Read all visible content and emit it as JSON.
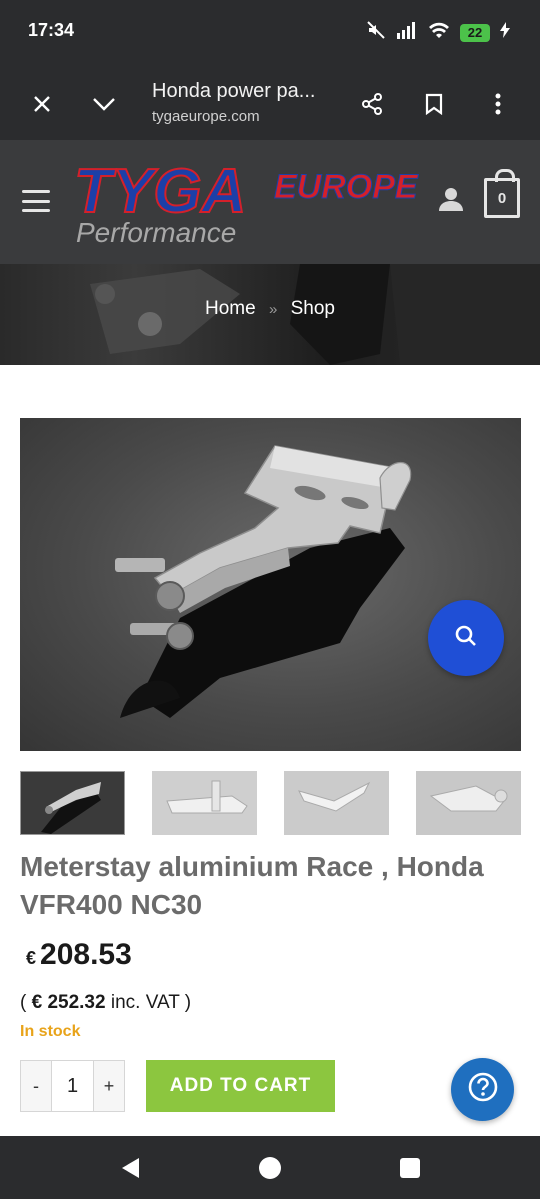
{
  "status_bar": {
    "time": "17:34",
    "battery": "22",
    "icons": [
      "mute-icon",
      "signal-icon",
      "wifi-icon",
      "battery-icon",
      "charging-icon"
    ]
  },
  "browser": {
    "title": "Honda power pa...",
    "domain": "tygaeurope.com",
    "icons": [
      "close-icon",
      "chevron-down-icon",
      "share-icon",
      "bookmark-icon",
      "more-vert-icon"
    ]
  },
  "header": {
    "logo_primary": "TYGA",
    "logo_secondary": "EUROPE",
    "logo_tagline": "Performance",
    "cart_count": "0",
    "colors": {
      "logo_blue": "#1c3fa8",
      "logo_red": "#d4202a",
      "header_bg": "#3a3b3d"
    }
  },
  "breadcrumb": {
    "home": "Home",
    "separator": "»",
    "shop": "Shop"
  },
  "product": {
    "title": "Meterstay aluminium Race , Honda VFR400 NC30",
    "currency": "€",
    "price": "208.53",
    "vat_open": "(",
    "vat_price": "€ 252.32",
    "vat_suffix": "inc. VAT )",
    "stock": "In stock",
    "quantity": "1",
    "qty_minus": "-",
    "qty_plus": "+",
    "add_to_cart": "ADD TO CART",
    "thumbnail_count": 4
  },
  "colors": {
    "add_to_cart": "#8cc63f",
    "stock": "#e8a31a",
    "zoom_button": "#1f4fd6",
    "help_button": "#1f6fbf"
  }
}
